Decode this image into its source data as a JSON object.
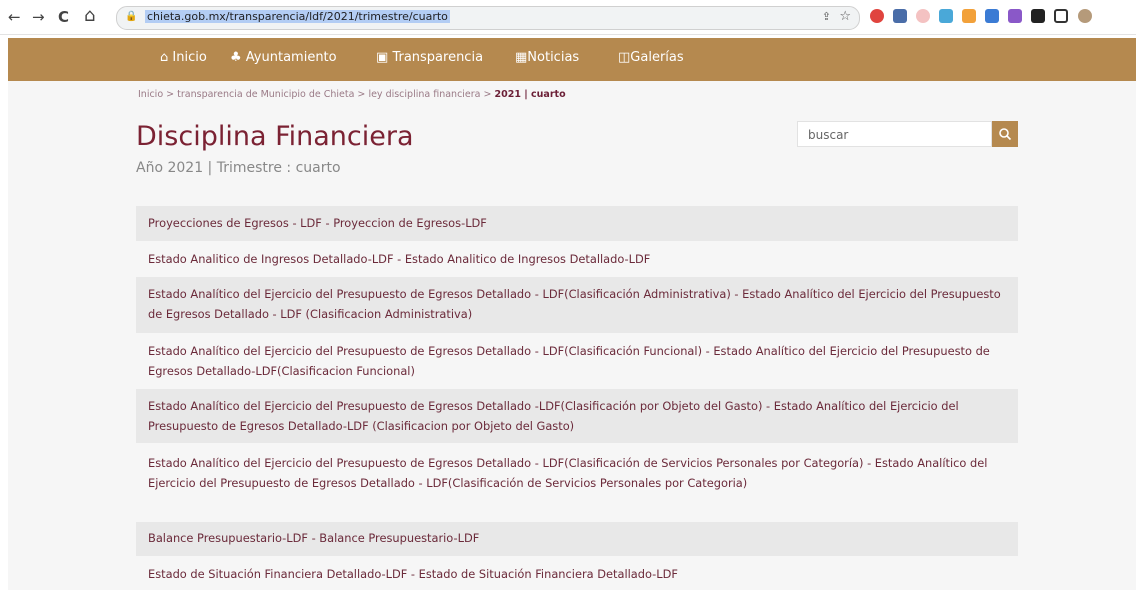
{
  "browser": {
    "url": "chieta.gob.mx/transparencia/ldf/2021/trimestre/cuarto",
    "back_icon": "←",
    "forward_icon": "→",
    "reload_icon": "C",
    "home_icon": "⌂",
    "lock_icon": "🔒",
    "share_icon": "⇪",
    "star_icon": "☆"
  },
  "nav": [
    {
      "label": "Inicio",
      "icon": "⌂"
    },
    {
      "label": "Ayuntamiento",
      "icon": "♣"
    },
    {
      "label": "Transparencia",
      "icon": "▣"
    },
    {
      "label": "Noticias",
      "icon": "▦"
    },
    {
      "label": "Galerías",
      "icon": "◫"
    }
  ],
  "breadcrumb": {
    "items": [
      "Inicio >",
      "transparencia de Municipio de Chieta >",
      "ley disciplina financiera >"
    ],
    "current": "2021 | cuarto"
  },
  "page": {
    "title": "Disciplina Financiera",
    "subtitle": "Año 2021 | Trimestre : cuarto"
  },
  "search": {
    "placeholder": "buscar",
    "icon": "search-icon"
  },
  "documents": [
    {
      "text": "Proyecciones de Egresos - LDF - Proyeccion de Egresos-LDF"
    },
    {
      "text": "Estado Analitico de Ingresos Detallado-LDF - Estado Analitico de Ingresos Detallado-LDF"
    },
    {
      "text": "Estado Analítico del Ejercicio del Presupuesto de Egresos Detallado - LDF(Clasificación Administrativa) - Estado Analítico del Ejercicio del Presupuesto de Egresos Detallado - LDF (Clasificacion Administrativa)"
    },
    {
      "text": "Estado Analítico del Ejercicio del Presupuesto de Egresos Detallado - LDF(Clasificación Funcional) - Estado Analítico del Ejercicio del Presupuesto de Egresos Detallado-LDF(Clasificacion Funcional)"
    },
    {
      "text": "Estado Analítico del Ejercicio del Presupuesto de Egresos Detallado -LDF(Clasificación por Objeto del Gasto) - Estado Analítico del Ejercicio del Presupuesto de Egresos Detallado-LDF (Clasificacion por Objeto del Gasto)"
    },
    {
      "text": "Estado Analítico del Ejercicio del Presupuesto de Egresos Detallado - LDF(Clasificación de Servicios Personales por Categoría) - Estado Analítico del Ejercicio del Presupuesto de Egresos Detallado - LDF(Clasificación de Servicios Personales por Categoria)"
    },
    {
      "text": "Balance Presupuestario-LDF - Balance Presupuestario-LDF"
    },
    {
      "text": "Estado de Situación Financiera Detallado-LDF - Estado de Situación Financiera Detallado-LDF"
    }
  ],
  "colors": {
    "brand": "#b5894f",
    "title": "#7b2233",
    "link": "#6b2a3a",
    "stripe": "#e8e8e8",
    "background": "#f6f6f6"
  }
}
